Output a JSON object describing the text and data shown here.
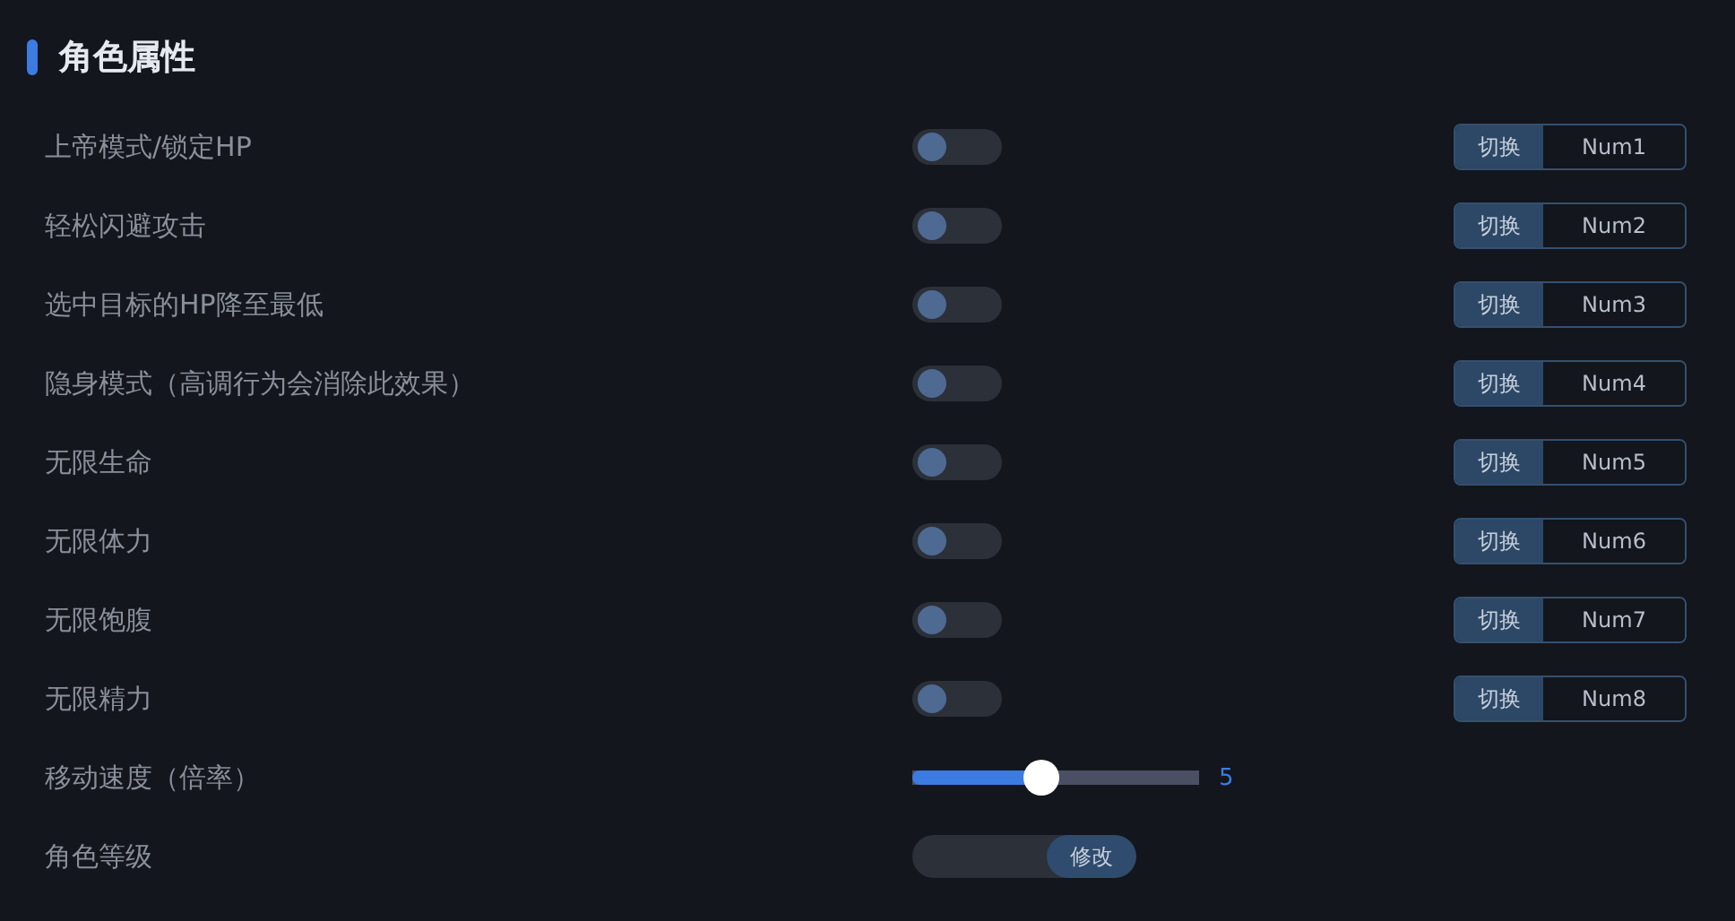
{
  "section": {
    "title": "角色属性"
  },
  "rows": [
    {
      "kind": "toggle",
      "label": "上帝模式/锁定HP",
      "on": false,
      "hotkey": {
        "action": "切换",
        "key": "Num1"
      }
    },
    {
      "kind": "toggle",
      "label": "轻松闪避攻击",
      "on": false,
      "hotkey": {
        "action": "切换",
        "key": "Num2"
      }
    },
    {
      "kind": "toggle",
      "label": "选中目标的HP降至最低",
      "on": false,
      "hotkey": {
        "action": "切换",
        "key": "Num3"
      }
    },
    {
      "kind": "toggle",
      "label": "隐身模式（高调行为会消除此效果）",
      "on": false,
      "hotkey": {
        "action": "切换",
        "key": "Num4"
      }
    },
    {
      "kind": "toggle",
      "label": "无限生命",
      "on": false,
      "hotkey": {
        "action": "切换",
        "key": "Num5"
      }
    },
    {
      "kind": "toggle",
      "label": "无限体力",
      "on": false,
      "hotkey": {
        "action": "切换",
        "key": "Num6"
      }
    },
    {
      "kind": "toggle",
      "label": "无限饱腹",
      "on": false,
      "hotkey": {
        "action": "切换",
        "key": "Num7"
      }
    },
    {
      "kind": "toggle",
      "label": "无限精力",
      "on": false,
      "hotkey": {
        "action": "切换",
        "key": "Num8"
      }
    },
    {
      "kind": "slider",
      "label": "移动速度（倍率）",
      "level": 0.44,
      "reading": "5"
    },
    {
      "kind": "input",
      "label": "角色等级",
      "button": "修改"
    }
  ]
}
